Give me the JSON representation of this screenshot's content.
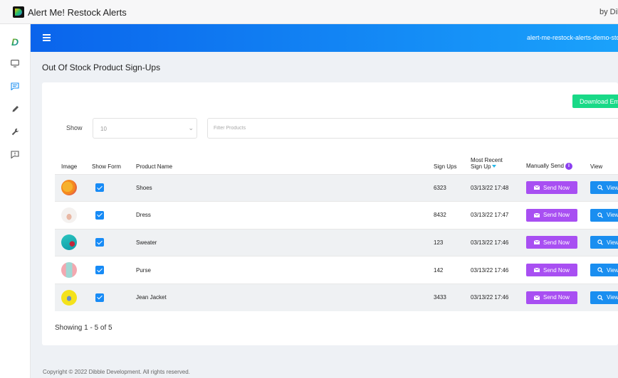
{
  "app": {
    "title": "Alert Me! Restock Alerts",
    "by": "by Dibb"
  },
  "header": {
    "store": "alert-me-restock-alerts-demo-sto"
  },
  "page": {
    "title": "Out Of Stock Product Sign-Ups"
  },
  "toolbar": {
    "download_label": "Download Em",
    "show_label": "Show",
    "show_value": "10",
    "filter_placeholder": "Filter Products"
  },
  "table": {
    "headers": {
      "image": "Image",
      "show_form": "Show Form",
      "product_name": "Product Name",
      "sign_ups": "Sign Ups",
      "most_recent_1": "Most Recent",
      "most_recent_2": "Sign Up",
      "manually_send": "Manually Send",
      "view": "View"
    },
    "rows": [
      {
        "name": "Shoes",
        "sign_ups": "6323",
        "recent": "03/13/22 17:48",
        "send": "Send Now",
        "view": "View"
      },
      {
        "name": "Dress",
        "sign_ups": "8432",
        "recent": "03/13/22 17:47",
        "send": "Send Now",
        "view": "View"
      },
      {
        "name": "Sweater",
        "sign_ups": "123",
        "recent": "03/13/22 17:46",
        "send": "Send Now",
        "view": "View"
      },
      {
        "name": "Purse",
        "sign_ups": "142",
        "recent": "03/13/22 17:46",
        "send": "Send Now",
        "view": "View"
      },
      {
        "name": "Jean Jacket",
        "sign_ups": "3433",
        "recent": "03/13/22 17:46",
        "send": "Send Now",
        "view": "View"
      }
    ]
  },
  "pagination": {
    "showing": "Showing 1 - 5 of 5"
  },
  "footer": {
    "copyright": "Copyright © 2022 Dibble Development. All rights reserved."
  },
  "colors": {
    "header_start": "#0a64ec",
    "header_end": "#1aa2fb",
    "send": "#a84ff2",
    "view": "#1a8ef0",
    "download": "#19d987",
    "checkbox": "#178bf6"
  },
  "icons": [
    "dibble-logo-icon",
    "monitor-icon",
    "chat-icon",
    "pencil-icon",
    "wrench-icon",
    "feedback-icon",
    "menu-icon",
    "envelope-icon",
    "search-icon",
    "info-icon",
    "sort-desc-icon",
    "chevron-down-icon"
  ]
}
